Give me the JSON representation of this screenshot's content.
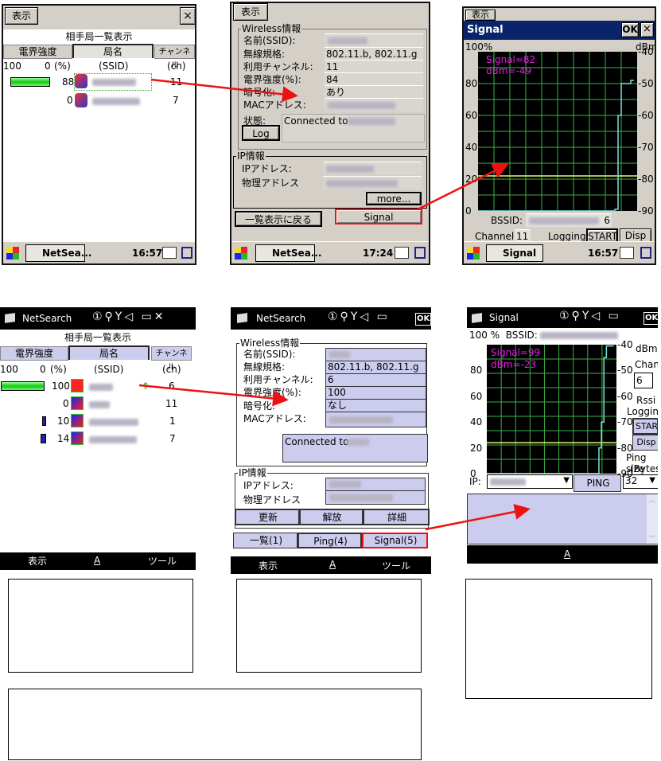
{
  "screen1": {
    "menu": "表示",
    "close": "×",
    "title": "相手局一覧表示",
    "tabs": [
      "電界強度",
      "局名",
      "チャンネル"
    ],
    "header": {
      "max": "100",
      "min": "0",
      "unit": "(%)",
      "ssid": "(SSID)",
      "ch": "(ch)"
    },
    "rows": [
      {
        "strength": "88",
        "channel": "11",
        "bar": 88
      },
      {
        "strength": "0",
        "channel": "7",
        "bar": 0
      }
    ],
    "taskbar": {
      "app": "NetSea...",
      "time": "16:57"
    }
  },
  "screen2": {
    "menu": "表示",
    "wireless_legend": "Wireless情報",
    "labels": [
      "名前(SSID):",
      "無線規格:",
      "利用チャンネル:",
      "電界強度(%):",
      "暗号化:",
      "MACアドレス:"
    ],
    "values": [
      "",
      "802.11.b, 802.11.g",
      "11",
      "84",
      "あり",
      ""
    ],
    "status_label": "状態:",
    "status": "Connected to",
    "log": "Log",
    "ip_legend": "IP情報",
    "ip_labels": [
      "IPアドレス:",
      "物理アドレス"
    ],
    "more": "more...",
    "back": "一覧表示に戻る",
    "signal": "Signal",
    "taskbar": {
      "app": "NetSea...",
      "time": "17:24"
    }
  },
  "screen3": {
    "tab": "表示",
    "title": "Signal",
    "ok": "OK",
    "close": "×",
    "left_top": "100%",
    "right_top": "dBm",
    "left_ticks": [
      "80",
      "60",
      "40",
      "20",
      "0"
    ],
    "right_ticks": [
      "-40",
      "-50",
      "-60",
      "-70",
      "-80",
      "-90"
    ],
    "signal": "Signal=82",
    "dbm": "dBm=-49",
    "bssid_label": "BSSID:",
    "bssid_tail": "6",
    "channel_label": "Channel:",
    "channel": "11",
    "logging_label": "Logging:",
    "start": "START",
    "disp": "Disp",
    "taskbar": {
      "app": "Signal",
      "time": "16:57"
    }
  },
  "screen4": {
    "app": "NetSearch",
    "title": "相手局一覧表示",
    "tabs": [
      "電界強度",
      "局名",
      "チャンネル"
    ],
    "header": {
      "max": "100",
      "min": "0",
      "unit": "(%)",
      "ssid": "(SSID)",
      "ch": "(ch)"
    },
    "rows": [
      {
        "strength": "100",
        "channel": "6"
      },
      {
        "strength": "0",
        "channel": "11"
      },
      {
        "strength": "10",
        "channel": "1"
      },
      {
        "strength": "14",
        "channel": "7"
      }
    ],
    "softkeys": [
      "表示",
      "A",
      "ツール"
    ]
  },
  "screen5": {
    "app": "NetSearch",
    "ok": "OK",
    "wireless_legend": "Wireless情報",
    "labels": [
      "名前(SSID):",
      "無線規格:",
      "利用チャンネル:",
      "電界強度(%):",
      "暗号化:",
      "MACアドレス:"
    ],
    "values": [
      "",
      "802.11.b, 802.11.g",
      "6",
      "100",
      "なし",
      ""
    ],
    "status": "Connected to",
    "ip_legend": "IP情報",
    "ip_labels": [
      "IPアドレス:",
      "物理アドレス"
    ],
    "buttons": [
      "更新",
      "解放",
      "詳細"
    ],
    "nav": [
      "一覧(1)",
      "Ping(4)",
      "Signal(5)"
    ],
    "softkeys": [
      "表示",
      "A",
      "ツール"
    ]
  },
  "screen6": {
    "app": "Signal",
    "ok": "OK",
    "top": "100 %  BSSID:",
    "left_ticks": [
      "80",
      "60",
      "40",
      "20",
      "0"
    ],
    "right_ticks": [
      "-40",
      "-50",
      "-60",
      "-70",
      "-80",
      "-90"
    ],
    "dbm_unit": "dBm",
    "signal": "Signal=99",
    "dbm": "dBm=-23",
    "chan_label": "Chan:",
    "chan": "6",
    "rssi": "Rssi",
    "logging_label": "Logging:",
    "start": "START",
    "disp": "Disp",
    "ping_size": "Ping size",
    "bytes": "(Bytes)",
    "ip_label": "IP:",
    "ping": "PING",
    "size": "32",
    "softkey": "A"
  },
  "colors": {
    "accent_red": "#ee1111",
    "title_navy": "#0a246a",
    "grid_green": "#3cb043",
    "trace": "#7fe0e0",
    "threshold": "#f0f080",
    "label_magenta": "#e020e0",
    "wm_lavender": "#ccccee"
  },
  "chart_data": [
    {
      "type": "line",
      "ylim": [
        0,
        100
      ],
      "y2lim": [
        -90,
        -40
      ],
      "threshold": 22,
      "values": [
        0,
        0,
        0,
        0,
        0,
        0,
        0,
        0,
        0,
        0,
        0,
        0,
        0,
        0,
        0,
        0,
        0,
        0,
        0,
        0,
        0,
        0,
        0,
        0,
        0,
        0,
        0,
        0,
        0,
        0,
        0,
        0,
        0,
        0,
        0,
        0,
        0,
        0,
        0,
        0,
        0,
        0,
        0,
        1,
        60,
        80,
        80,
        80,
        82,
        82
      ]
    },
    {
      "type": "line",
      "ylim": [
        0,
        100
      ],
      "y2lim": [
        -90,
        -40
      ],
      "threshold": 24,
      "values": [
        0,
        0,
        0,
        0,
        0,
        0,
        0,
        0,
        0,
        0,
        0,
        0,
        0,
        0,
        0,
        0,
        0,
        0,
        0,
        0,
        0,
        0,
        0,
        0,
        0,
        0,
        0,
        0,
        0,
        0,
        0,
        0,
        0,
        0,
        0,
        0,
        0,
        0,
        0,
        0,
        0,
        0,
        0,
        0,
        0,
        20,
        40,
        90,
        99,
        99,
        99,
        99
      ]
    }
  ]
}
